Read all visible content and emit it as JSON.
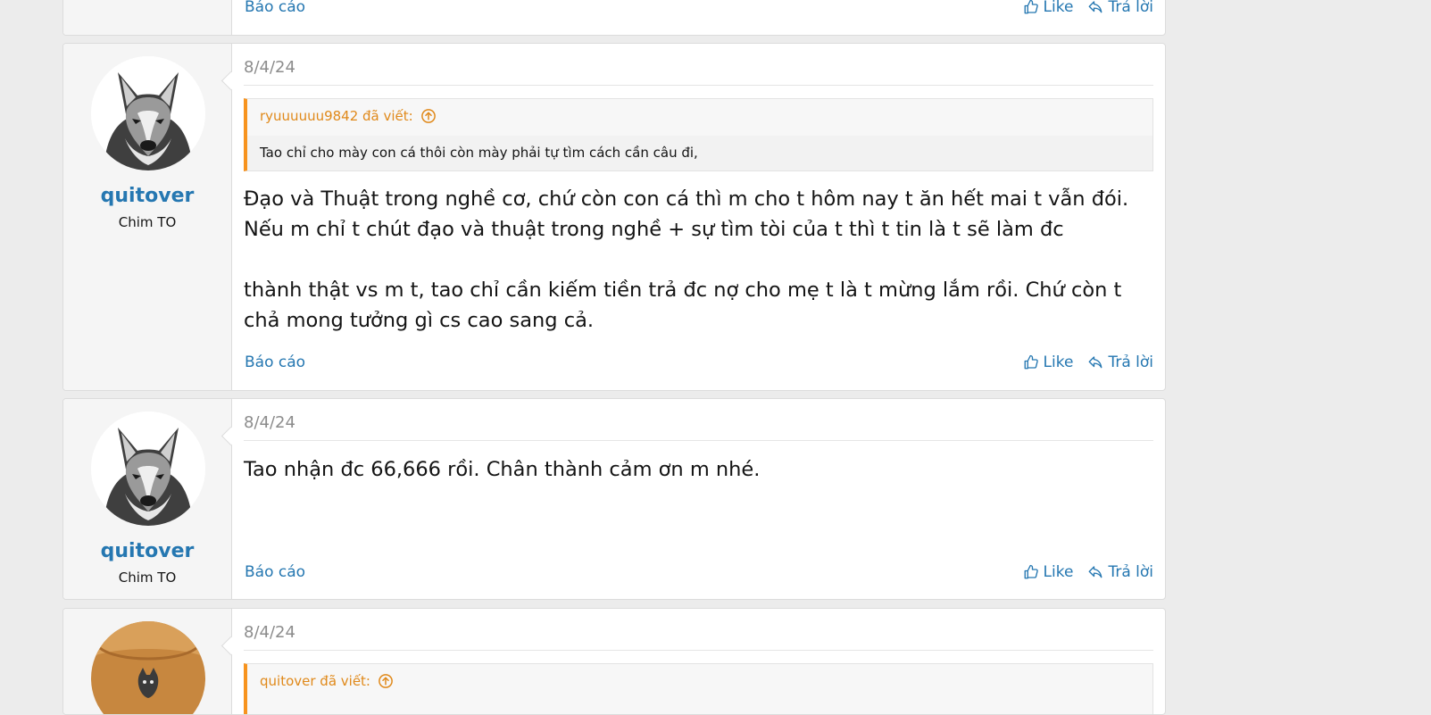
{
  "actions": {
    "report": "Báo cáo",
    "like": "Like",
    "reply": "Trả lời"
  },
  "posts": [
    {
      "date": "",
      "username": "",
      "user_title": ""
    },
    {
      "date": "8/4/24",
      "username": "quitover",
      "user_title": "Chim TO",
      "quote": {
        "author": "ryuuuuuu9842 đã viết:",
        "text": "Tao chỉ cho mày con cá thôi còn mày phải tự tìm cách cần câu đi,"
      },
      "message": [
        "Đạo và Thuật trong nghề cơ, chứ còn con cá thì m cho t hôm nay t ăn hết mai t vẫn đói.",
        "Nếu m chỉ t chút đạo và thuật trong nghề + sự tìm tòi của t thì t tin là t sẽ làm đc",
        "thành thật vs m t, tao chỉ cần kiếm tiền trả đc nợ cho mẹ t là t mừng lắm rồi. Chứ còn t chả mong tưởng gì cs cao sang cả."
      ]
    },
    {
      "date": "8/4/24",
      "username": "quitover",
      "user_title": "Chim TO",
      "message": [
        "Tao nhận đc 66,666 rồi. Chân thành cảm ơn m nhé."
      ]
    },
    {
      "date": "8/4/24",
      "quote": {
        "author": "quitover đã viết:"
      }
    }
  ]
}
